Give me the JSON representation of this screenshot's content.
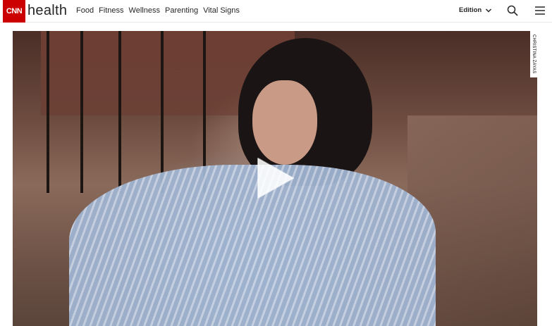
{
  "header": {
    "logo_text": "CNN",
    "brand_word": "health",
    "nav": [
      {
        "label": "Food"
      },
      {
        "label": "Fitness"
      },
      {
        "label": "Wellness"
      },
      {
        "label": "Parenting"
      },
      {
        "label": "Vital Signs"
      }
    ],
    "edition_label": "Edition",
    "icons": {
      "edition": "chevron-down-icon",
      "search": "search-icon",
      "menu": "hamburger-menu-icon"
    }
  },
  "media": {
    "photo_credit": "CHRISTINA ZAYAS",
    "play_icon": "play-icon"
  },
  "colors": {
    "brand_red": "#cc0000",
    "text": "#262626"
  }
}
